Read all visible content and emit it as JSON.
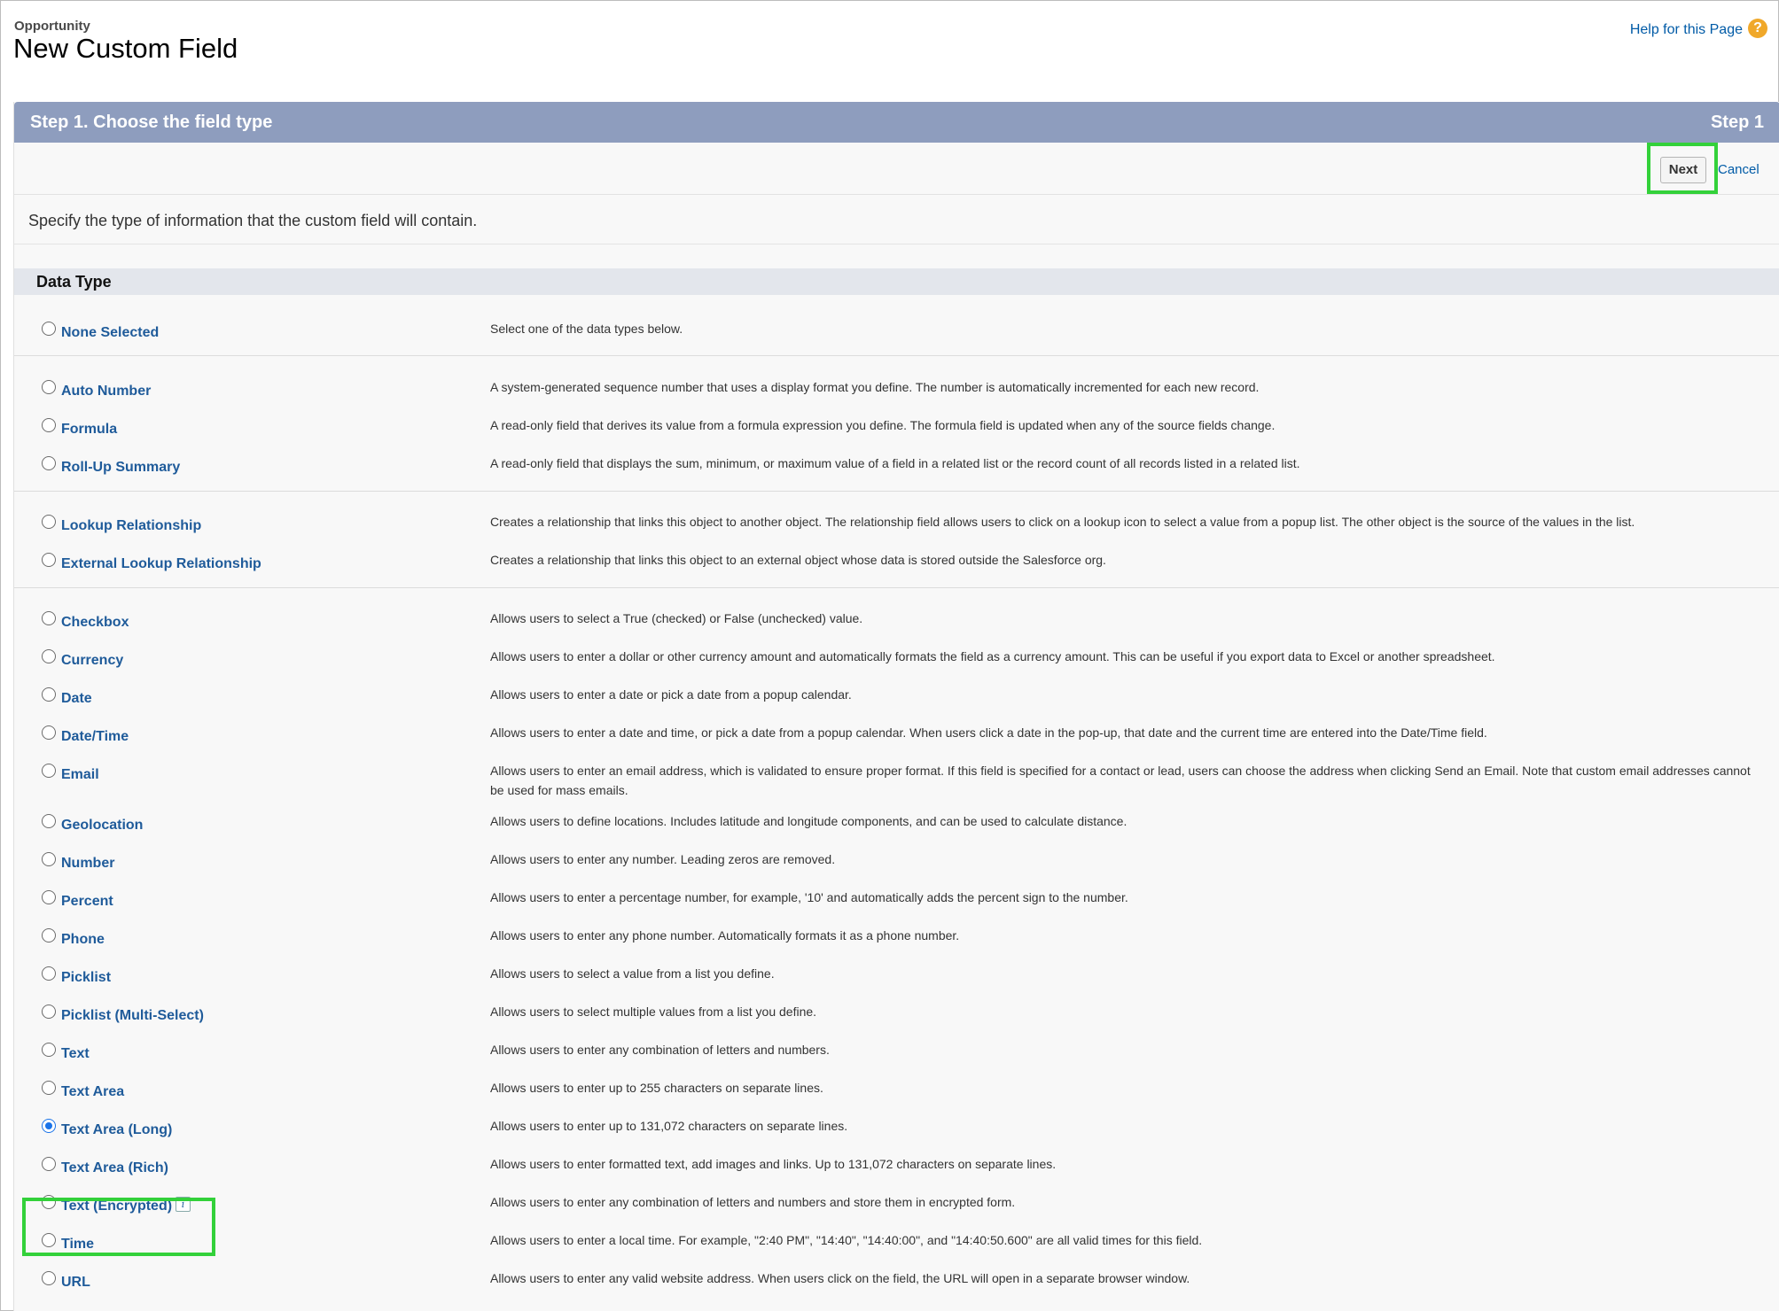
{
  "header": {
    "object_name": "Opportunity",
    "title": "New Custom Field",
    "help_link": "Help for this Page",
    "help_icon": "?"
  },
  "step": {
    "title": "Step 1. Choose the field type",
    "label": "Step 1",
    "next_label": "Next",
    "cancel_label": "Cancel",
    "intro": "Specify the type of information that the custom field will contain."
  },
  "data_type": {
    "heading": "Data Type",
    "items": [
      {
        "label": "None Selected",
        "desc": "Select one of the data types below.",
        "checked": false
      },
      {
        "label": "Auto Number",
        "desc": "A system-generated sequence number that uses a display format you define. The number is automatically incremented for each new record.",
        "checked": false
      },
      {
        "label": "Formula",
        "desc": "A read-only field that derives its value from a formula expression you define. The formula field is updated when any of the source fields change.",
        "checked": false
      },
      {
        "label": "Roll-Up Summary",
        "desc": "A read-only field that displays the sum, minimum, or maximum value of a field in a related list or the record count of all records listed in a related list.",
        "checked": false
      },
      {
        "label": "Lookup Relationship",
        "desc": "Creates a relationship that links this object to another object. The relationship field allows users to click on a lookup icon to select a value from a popup list. The other object is the source of the values in the list.",
        "checked": false
      },
      {
        "label": "External Lookup Relationship",
        "desc": "Creates a relationship that links this object to an external object whose data is stored outside the Salesforce org.",
        "checked": false
      },
      {
        "label": "Checkbox",
        "desc": "Allows users to select a True (checked) or False (unchecked) value.",
        "checked": false
      },
      {
        "label": "Currency",
        "desc": "Allows users to enter a dollar or other currency amount and automatically formats the field as a currency amount. This can be useful if you export data to Excel or another spreadsheet.",
        "checked": false
      },
      {
        "label": "Date",
        "desc": "Allows users to enter a date or pick a date from a popup calendar.",
        "checked": false
      },
      {
        "label": "Date/Time",
        "desc": "Allows users to enter a date and time, or pick a date from a popup calendar. When users click a date in the pop-up, that date and the current time are entered into the Date/Time field.",
        "checked": false
      },
      {
        "label": "Email",
        "desc": "Allows users to enter an email address, which is validated to ensure proper format. If this field is specified for a contact or lead, users can choose the address when clicking Send an Email. Note that custom email addresses cannot be used for mass emails.",
        "checked": false
      },
      {
        "label": "Geolocation",
        "desc": "Allows users to define locations. Includes latitude and longitude components, and can be used to calculate distance.",
        "checked": false
      },
      {
        "label": "Number",
        "desc": "Allows users to enter any number. Leading zeros are removed.",
        "checked": false
      },
      {
        "label": "Percent",
        "desc": "Allows users to enter a percentage number, for example, '10' and automatically adds the percent sign to the number.",
        "checked": false
      },
      {
        "label": "Phone",
        "desc": "Allows users to enter any phone number. Automatically formats it as a phone number.",
        "checked": false
      },
      {
        "label": "Picklist",
        "desc": "Allows users to select a value from a list you define.",
        "checked": false
      },
      {
        "label": "Picklist (Multi-Select)",
        "desc": "Allows users to select multiple values from a list you define.",
        "checked": false
      },
      {
        "label": "Text",
        "desc": "Allows users to enter any combination of letters and numbers.",
        "checked": false
      },
      {
        "label": "Text Area",
        "desc": "Allows users to enter up to 255 characters on separate lines.",
        "checked": false
      },
      {
        "label": "Text Area (Long)",
        "desc": "Allows users to enter up to 131,072 characters on separate lines.",
        "checked": true
      },
      {
        "label": "Text Area (Rich)",
        "desc": "Allows users to enter formatted text, add images and links. Up to 131,072 characters on separate lines.",
        "checked": false
      },
      {
        "label": "Text (Encrypted)",
        "desc": "Allows users to enter any combination of letters and numbers and store them in encrypted form.",
        "checked": false,
        "info_icon": "i"
      },
      {
        "label": "Time",
        "desc": "Allows users to enter a local time. For example, \"2:40 PM\", \"14:40\", \"14:40:00\", and \"14:40:50.600\" are all valid times for this field.",
        "checked": false
      },
      {
        "label": "URL",
        "desc": "Allows users to enter any valid website address. When users click on the field, the URL will open in a separate browser window.",
        "checked": false
      }
    ]
  }
}
